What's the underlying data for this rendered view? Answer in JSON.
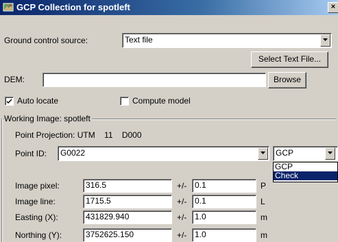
{
  "window": {
    "title": "GCP Collection for spotleft",
    "close_label": "×"
  },
  "ground_control": {
    "label": "Ground control source:",
    "value": "Text file",
    "select_button": "Select Text File..."
  },
  "dem": {
    "label": "DEM:",
    "value": "",
    "browse_button": "Browse"
  },
  "options": {
    "auto_locate_label": "Auto locate",
    "auto_locate_checked": true,
    "compute_model_label": "Compute model",
    "compute_model_checked": false
  },
  "working_image": {
    "group_label": "Working Image: spotleft",
    "projection_label": "Point Projection: UTM    11    D000",
    "point_id_label": "Point ID:",
    "point_id_value": "G0022",
    "type_value": "GCP",
    "type_options": [
      "GCP",
      "Check"
    ],
    "type_selected_index": 1
  },
  "fields": [
    {
      "label": "Image pixel:",
      "value": "316.5",
      "pm": "+/-",
      "tol": "0.1",
      "unit": "P"
    },
    {
      "label": "Image line:",
      "value": "1715.5",
      "pm": "+/-",
      "tol": "0.1",
      "unit": "L"
    },
    {
      "label": "Easting (X):",
      "value": "431829.940",
      "pm": "+/-",
      "tol": "1.0",
      "unit": "m"
    },
    {
      "label": "Northing (Y):",
      "value": "3752625.150",
      "pm": "+/-",
      "tol": "1.0",
      "unit": "m"
    }
  ]
}
